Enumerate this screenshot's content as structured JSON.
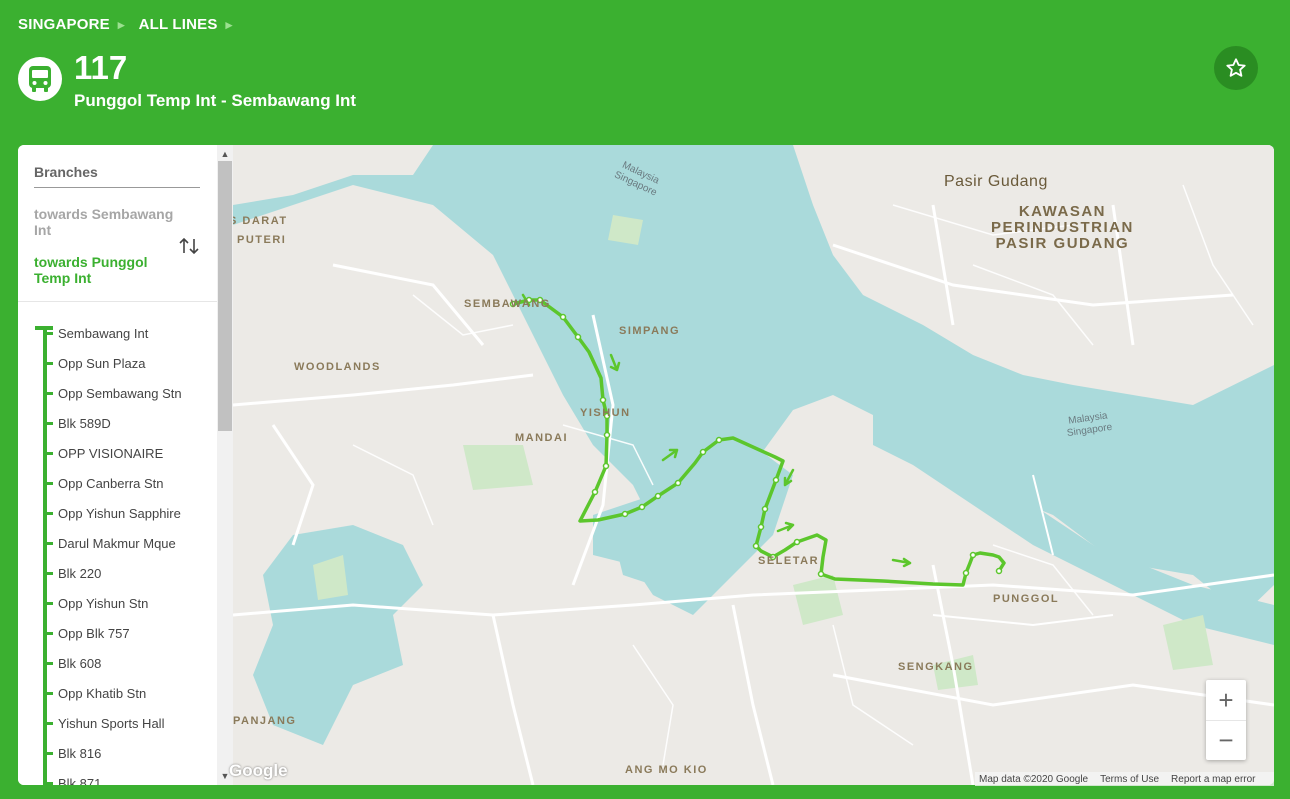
{
  "breadcrumb": {
    "items": [
      "SINGAPORE",
      "ALL LINES"
    ]
  },
  "line": {
    "number": "117",
    "name": "Punggol Temp Int - Sembawang Int",
    "icon": "bus-icon"
  },
  "favorite": {
    "icon": "star-outline-icon"
  },
  "branches": {
    "title": "Branches",
    "items": [
      {
        "label": "towards Sembawang Int",
        "active": false
      },
      {
        "label": "towards Punggol Temp Int",
        "active": true
      }
    ],
    "swap_icon": "swap-arrows-icon"
  },
  "stops": [
    "Sembawang Int",
    "Opp Sun Plaza",
    "Opp Sembawang Stn",
    "Blk 589D",
    "OPP VISIONAIRE",
    "Opp Canberra Stn",
    "Opp Yishun Sapphire",
    "Darul Makmur Mque",
    "Blk 220",
    "Opp Yishun Stn",
    "Opp Blk 757",
    "Blk 608",
    "Opp Khatib Stn",
    "Yishun Sports Hall",
    "Blk 816",
    "Blk 871"
  ],
  "map": {
    "places": {
      "sembawang": "SEMBAWANG",
      "simpang": "SIMPANG",
      "woodlands": "WOODLANDS",
      "yishun": "YISHUN",
      "mandai": "MANDAI",
      "seletar": "SELETAR",
      "punggol": "PUNGGOL",
      "sengkang": "SENGKANG",
      "ang_mo_kio": "ANG MO KIO",
      "panjang": "PANJANG",
      "darat": "S DARAT",
      "puteri": "PUTERI"
    },
    "pasir_gudang": "Pasir Gudang",
    "kawasan": [
      "KAWASAN",
      "PERINDUSTRIAN",
      "PASIR GUDANG"
    ],
    "border_a": [
      "Malaysia",
      "Singapore"
    ],
    "border_b": [
      "Malaysia",
      "Singapore"
    ],
    "zoom_in": "+",
    "zoom_out": "−",
    "google": "Google",
    "attribution": {
      "data": "Map data ©2020 Google",
      "terms": "Terms of Use",
      "report": "Report a map error"
    }
  },
  "colors": {
    "brand": "#3bb030",
    "water": "#aadadb",
    "land": "#eceae6",
    "route": "#5cc62c"
  }
}
